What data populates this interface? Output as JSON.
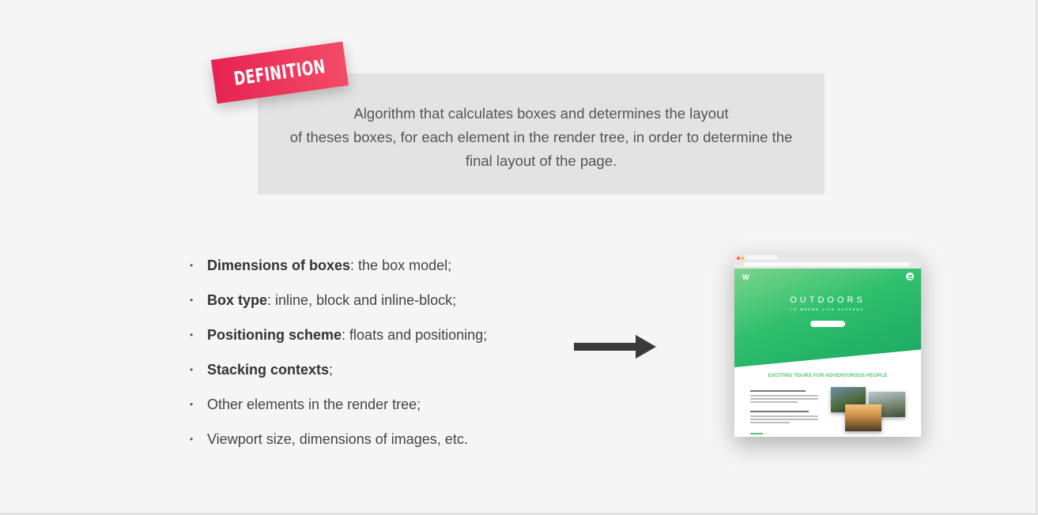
{
  "definition": {
    "tag_label": "DEFINITION",
    "text": "Algorithm that calculates boxes and determines the layout\nof theses boxes, for each element in the render tree, in order to determine the\nfinal layout of the page."
  },
  "bullets": [
    {
      "bold": "Dimensions of boxes",
      "rest": ": the box model;"
    },
    {
      "bold": "Box type",
      "rest": ": inline, block and inline-block;"
    },
    {
      "bold": "Positioning scheme",
      "rest": ": floats and positioning;"
    },
    {
      "bold": "Stacking contexts",
      "rest": ";"
    },
    {
      "bold": "",
      "rest": "Other elements in the render tree;"
    },
    {
      "bold": "",
      "rest": "Viewport size, dimensions of images, etc."
    }
  ],
  "thumbnail": {
    "logo": "W",
    "hero_title": "OUTDOORS",
    "hero_subtitle": "IS WHERE LIFE HAPPENS",
    "section_title": "EXCITING TOURS FOR ADVENTUROUS PEOPLE"
  },
  "colors": {
    "tag_red": "#e62352",
    "accent_green": "#55c57a",
    "arrow": "#3a3a3a"
  },
  "icons": {
    "arrow": "right-arrow-icon",
    "menu": "menu-icon"
  }
}
